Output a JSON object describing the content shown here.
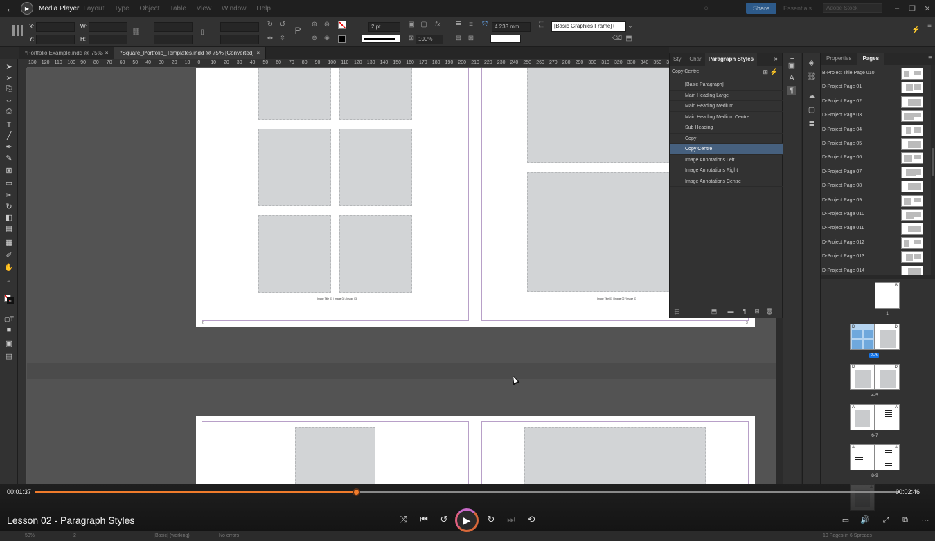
{
  "titlebar": {
    "app_title": "Media Player",
    "menu": [
      "Layout",
      "Type",
      "Object",
      "Table",
      "View",
      "Window",
      "Help"
    ],
    "share": "Share",
    "workspace": "Essentials",
    "search_placeholder": "Adobe Stock"
  },
  "controlbar": {
    "x_label": "X:",
    "y_label": "Y:",
    "w_label": "W:",
    "h_label": "H:",
    "stroke_weight": "2 pt",
    "opacity": "100%",
    "gap_value": "4.233 mm",
    "object_style": "[Basic Graphics Frame]+"
  },
  "doc_tabs": [
    {
      "label": "*Portfolio Example.indd @ 75%",
      "close": "×"
    },
    {
      "label": "*Square_Portfolio_Templates.indd @ 75% [Converted]",
      "close": "×"
    }
  ],
  "ruler_labels": [
    "130",
    "120",
    "110",
    "100",
    "90",
    "80",
    "70",
    "60",
    "50",
    "40",
    "30",
    "20",
    "10",
    "0",
    "10",
    "20",
    "30",
    "40",
    "50",
    "60",
    "70",
    "80",
    "90",
    "100",
    "110",
    "120",
    "130",
    "140",
    "150",
    "160",
    "170",
    "180",
    "190",
    "200",
    "210",
    "220",
    "230",
    "240",
    "250",
    "260",
    "270",
    "280",
    "290",
    "300",
    "310",
    "320",
    "330",
    "340",
    "350",
    "36"
  ],
  "canvas": {
    "caption_left": "Image Title 01 / Image 02 / Image 03",
    "caption_right": "Image Title 01 / Image 02 / Image 03",
    "page_num_left": "2",
    "page_num_right": "3"
  },
  "paragraph_styles_panel": {
    "tabs": [
      "Styl",
      "Char",
      "Paragraph Styles"
    ],
    "expand": "»",
    "current_style": "Copy Centre",
    "styles": [
      "[Basic Paragraph]",
      "Main Heading Large",
      "Main Heading Medium",
      "Main Heading Medium Centre",
      "Sub Heading",
      "Copy",
      "Copy Centre",
      "Image Annotations Left",
      "Image Annotations Right",
      "Image Annotations Centre"
    ],
    "selected_index": 6
  },
  "pages_panel": {
    "tabs": [
      "Properties",
      "Pages"
    ],
    "masters": [
      "B-Project Title Page 010",
      "D-Project Page 01",
      "D-Project Page 02",
      "D-Project Page 03",
      "D-Project Page 04",
      "D-Project Page 05",
      "D-Project Page 06",
      "D-Project Page 07",
      "D-Project Page 08",
      "D-Project Page 09",
      "D-Project Page 010",
      "D-Project Page 011",
      "D-Project Page 012",
      "D-Project Page 013",
      "D-Project Page 014"
    ],
    "spreads": [
      {
        "label": "1",
        "masters": [
          "B"
        ]
      },
      {
        "label": "2-3",
        "masters": [
          "D",
          "D"
        ]
      },
      {
        "label": "4-5",
        "masters": [
          "D",
          "D"
        ]
      },
      {
        "label": "6-7",
        "masters": [
          "A",
          "A"
        ]
      },
      {
        "label": "8-9",
        "masters": [
          "A",
          "A"
        ]
      },
      {
        "label": "",
        "masters": [
          "A"
        ]
      }
    ],
    "selected_spread": "2-3"
  },
  "statusbar": {
    "zoom": "50%",
    "page": "2",
    "style": "[Basic] (working)",
    "preflight": "No errors",
    "summary": "10 Pages in 6 Spreads"
  },
  "player": {
    "elapsed": "00:01:37",
    "duration": "00:02:46",
    "progress": 0.371,
    "lesson_title": "Lesson 02 - Paragraph Styles",
    "accent": "#f07b2b"
  },
  "colors": {
    "selection": "#46607e",
    "pages_selection": "#1473e6",
    "pasteboard": "#535353"
  }
}
